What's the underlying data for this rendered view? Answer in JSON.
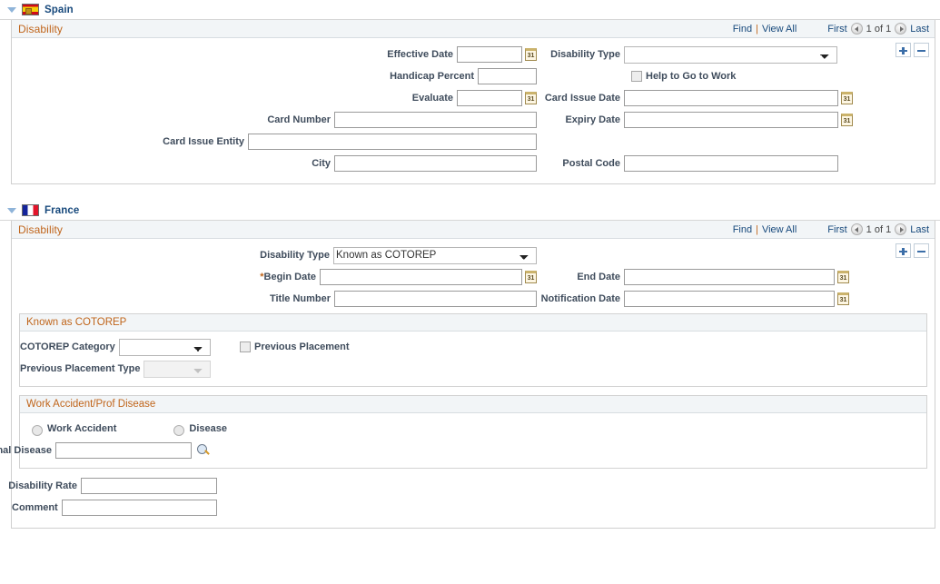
{
  "spain": {
    "country_label": "Spain",
    "flag_icon": "flag-spain-icon",
    "panel": {
      "title": "Disability",
      "find_label": "Find",
      "separator": "|",
      "view_all_label": "View All",
      "first_label": "First",
      "count_label": "1 of 1",
      "last_label": "Last",
      "add_row_label": "+",
      "delete_row_label": "-"
    },
    "fields": {
      "effective_date_label": "Effective Date",
      "effective_date_value": "",
      "handicap_percent_label": "Handicap Percent",
      "handicap_percent_value": "",
      "evaluate_label": "Evaluate",
      "evaluate_value": "",
      "card_number_label": "Card Number",
      "card_number_value": "",
      "card_issue_entity_label": "Card Issue Entity",
      "card_issue_entity_value": "",
      "city_label": "City",
      "city_value": "",
      "disability_type_label": "Disability Type",
      "disability_type_value": "",
      "help_to_go_to_work_label": "Help to Go to Work",
      "card_issue_date_label": "Card Issue Date",
      "card_issue_date_value": "",
      "expiry_date_label": "Expiry Date",
      "expiry_date_value": "",
      "postal_code_label": "Postal Code",
      "postal_code_value": ""
    }
  },
  "france": {
    "country_label": "France",
    "flag_icon": "flag-france-icon",
    "panel": {
      "title": "Disability",
      "find_label": "Find",
      "separator": "|",
      "view_all_label": "View All",
      "first_label": "First",
      "count_label": "1 of 1",
      "last_label": "Last",
      "add_row_label": "+",
      "delete_row_label": "-"
    },
    "fields": {
      "disability_type_label": "Disability Type",
      "disability_type_value": "Known as COTOREP",
      "begin_date_label": "Begin Date",
      "begin_date_required_marker": "*",
      "begin_date_value": "",
      "title_number_label": "Title Number",
      "title_number_value": "",
      "end_date_label": "End Date",
      "end_date_value": "",
      "notification_date_label": "Notification Date",
      "notification_date_value": ""
    },
    "cotorep": {
      "title": "Known as COTOREP",
      "category_label": "COTOREP Category",
      "category_value": "",
      "previous_placement_label": "Previous Placement",
      "previous_placement_type_label": "Previous Placement Type",
      "previous_placement_type_value": ""
    },
    "work_accident": {
      "title": "Work Accident/Prof Disease",
      "work_accident_label": "Work Accident",
      "disease_label": "Disease",
      "professional_disease_label": "Professional Disease",
      "professional_disease_value": ""
    },
    "bottom": {
      "disability_rate_label": "Disability Rate",
      "disability_rate_value": "",
      "comment_label": "Comment",
      "comment_value": ""
    }
  },
  "icons": {
    "calendar": "31",
    "collapse": "collapse-triangle-icon",
    "lookup": "lookup-magnifier-icon"
  }
}
